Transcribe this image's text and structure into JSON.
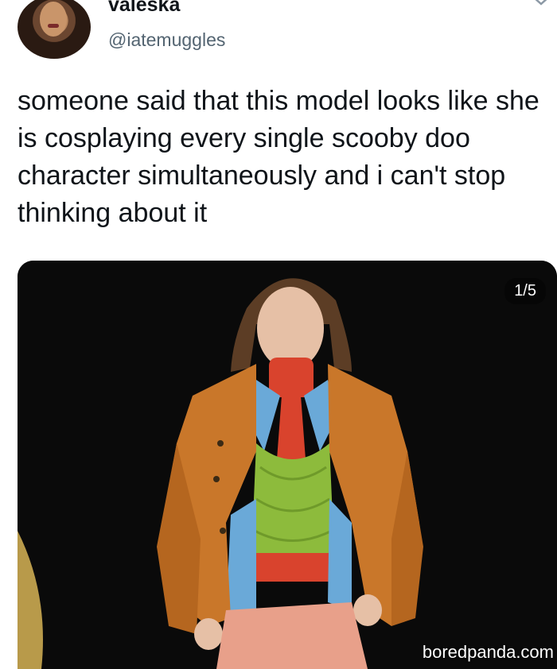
{
  "author": {
    "display_name": "valeska",
    "handle": "@iatemuggles"
  },
  "tweet": {
    "text": "someone said that this model looks like she is cosplaying every single scooby doo character simultaneously and i can't stop thinking about it"
  },
  "media": {
    "counter": "1/5",
    "watermark": "boredpanda.com"
  },
  "icons": {
    "menu": "chevron-down-icon"
  },
  "colors": {
    "text": "#0f1419",
    "secondary_text": "#536471",
    "jacket": "#c9772a",
    "turtleneck": "#d9432d",
    "top": "#8dbb3c",
    "shirt": "#6aa9d8",
    "pants": "#e8a08a"
  }
}
